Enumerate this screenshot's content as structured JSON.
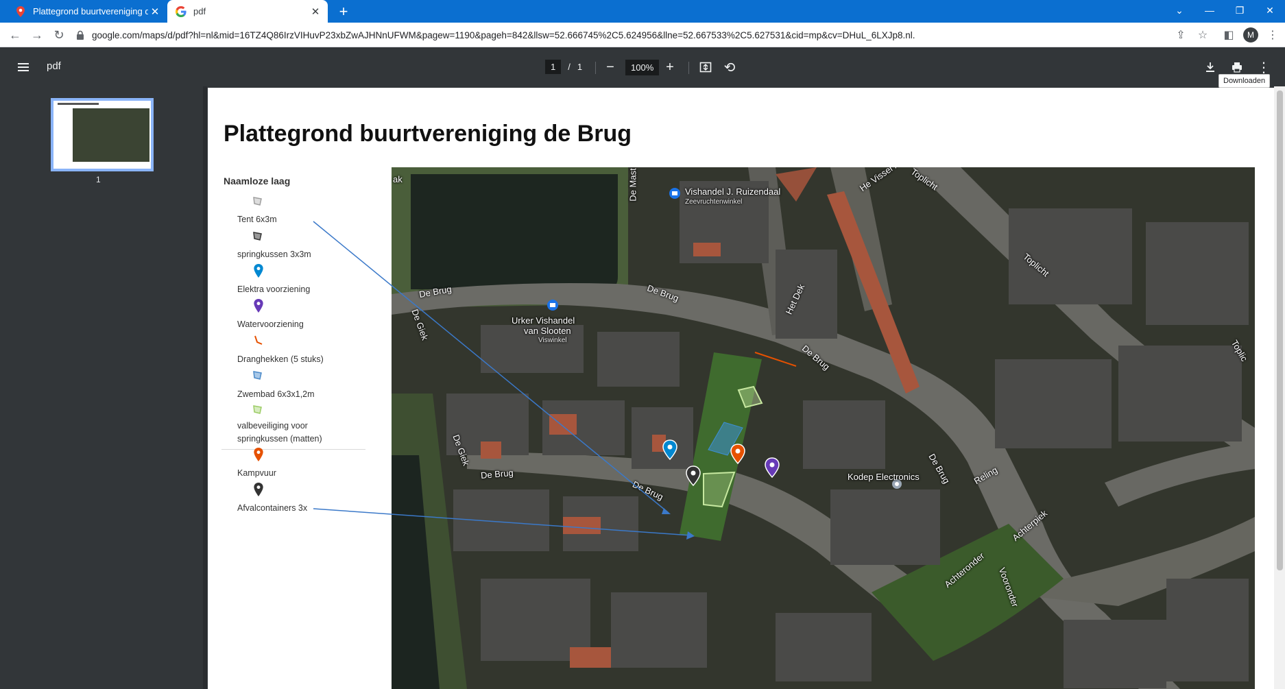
{
  "browser": {
    "tabs": [
      {
        "title": "Plattegrond buurtvereniging de Brug",
        "active": false
      },
      {
        "title": "pdf",
        "active": true
      }
    ],
    "url": "google.com/maps/d/pdf?hl=nl&mid=16TZ4Q86IrzVIHuvP23xbZwAJHNnUFWM&pagew=1190&pageh=842&llsw=52.666745%2C5.624956&llne=52.667533%2C5.627531&cid=mp&cv=DHuL_6LXJp8.nl.",
    "profile_initial": "M",
    "colors": {
      "tabstrip": "#0b6fd0",
      "toolbar": "#ffffff"
    }
  },
  "viewer": {
    "title": "pdf",
    "current_page": "1",
    "page_separator": "/",
    "total_pages": "1",
    "zoom": "100%",
    "download_tooltip": "Downloaden",
    "thumbnail_label": "1",
    "colors": {
      "bar": "#323639",
      "thumb_border": "#8ab4f8"
    }
  },
  "document": {
    "title": "Plattegrond buurtvereniging de Brug",
    "legend": {
      "heading": "Naamloze laag",
      "items": [
        {
          "label": "Tent 6x3m",
          "icon": "polygon-grey-icon",
          "color": "#9e9e9e"
        },
        {
          "label": "springkussen 3x3m",
          "icon": "polygon-dark-icon",
          "color": "#333333"
        },
        {
          "label": "Elektra voorziening",
          "icon": "pin-blue-icon",
          "color": "#0288d1"
        },
        {
          "label": "Watervoorziening",
          "icon": "pin-purple-icon",
          "color": "#673ab7"
        },
        {
          "label": "Dranghekken (5 stuks)",
          "icon": "line-orange-icon",
          "color": "#e65100"
        },
        {
          "label": "Zwembad 6x3x1,2m",
          "icon": "polygon-blue-icon",
          "color": "#4a89c8"
        },
        {
          "label": "valbeveiliging voor",
          "label2": "springkussen (matten)",
          "icon": "polygon-green-icon",
          "color": "#9ccc65"
        },
        {
          "label": "Kampvuur",
          "icon": "pin-orange-icon",
          "color": "#e65100"
        },
        {
          "label": "Afvalcontainers 3x",
          "icon": "pin-black-icon",
          "color": "#333333"
        }
      ]
    },
    "map_labels": {
      "vishandel_ruizendaal": "Vishandel J. Ruizendaal",
      "zeevruchtenwinkel": "Zeevruchtenwinkel",
      "urker_1": "Urker Vishandel",
      "urker_2": "van Slooten",
      "viswinkel": "Viswinkel",
      "kodep": "Kodep Electronics",
      "de_brug_1": "De Brug",
      "de_brug_2": "De Brug",
      "de_brug_3": "De Brug",
      "de_brug_4": "De Brug",
      "de_brug_5": "De Brug",
      "de_brug_6": "De Brug",
      "de_giek_1": "De Giek",
      "de_giek_2": "De Giek",
      "het_dek": "Het Dek",
      "toplicht_1": "Toplicht",
      "toplicht_2": "Toplicht",
      "toplicht_3": "Toplic",
      "reling": "Reling",
      "achterpiek": "Achterpiek",
      "achteronder": "Achteronder",
      "voorronder": "Vooronder",
      "de_mast": "De Mast",
      "visser": "He  Visser  A",
      "edge_left": "ak"
    }
  }
}
